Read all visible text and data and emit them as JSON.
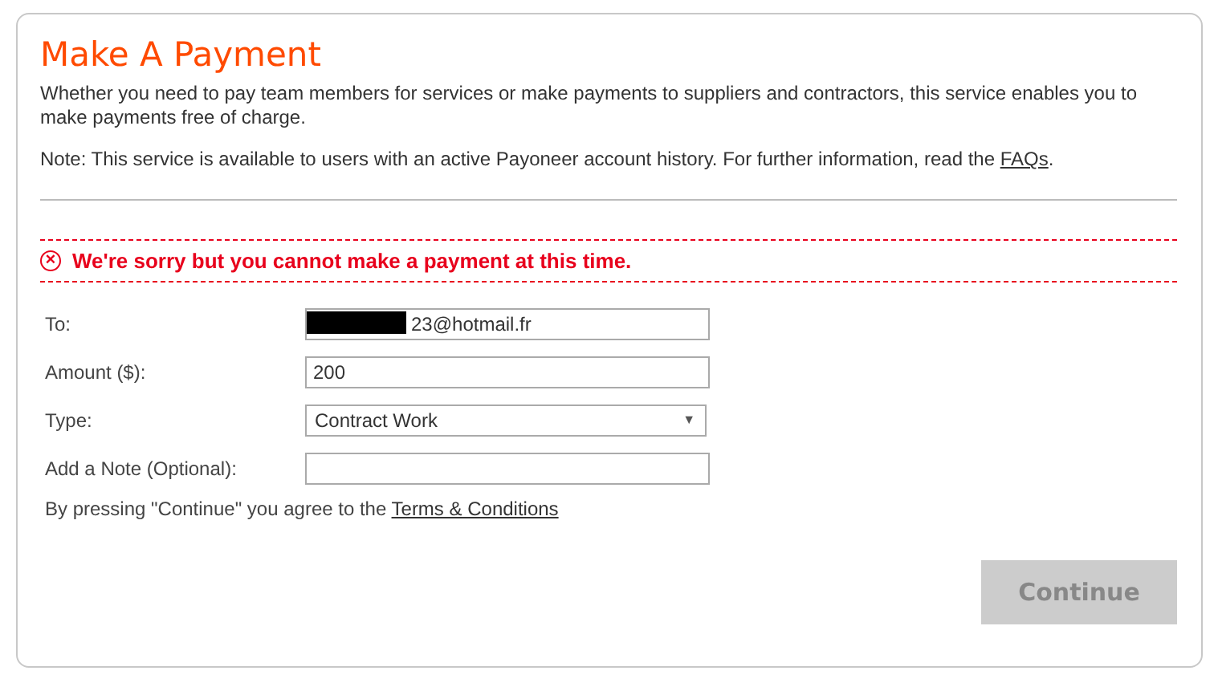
{
  "title": "Make A Payment",
  "intro": "Whether you need to pay team members for services or make payments to suppliers and contractors, this service enables you to make payments free of charge.",
  "note": {
    "text": "Note: This service is available to users with an active Payoneer account history. For further information, read the ",
    "link": "FAQs",
    "after": "."
  },
  "error": {
    "icon": "×",
    "message": "We're sorry but you cannot make a payment at this time."
  },
  "fields": [
    {
      "kind": "text",
      "label": "To:",
      "value": "23@hotmail.fr",
      "redacted": true
    },
    {
      "kind": "text",
      "label": "Amount ($):",
      "value": "200",
      "redacted": false
    },
    {
      "kind": "select",
      "label": "Type:",
      "value": "Contract Work",
      "arrow": "▼"
    },
    {
      "kind": "text",
      "label": "Add a Note (Optional):",
      "redacted": false
    }
  ],
  "terms": {
    "text": "By pressing \"Continue\" you agree to the ",
    "link": "Terms & Conditions"
  },
  "continue_button": {
    "label": "Continue",
    "disabled": true
  }
}
